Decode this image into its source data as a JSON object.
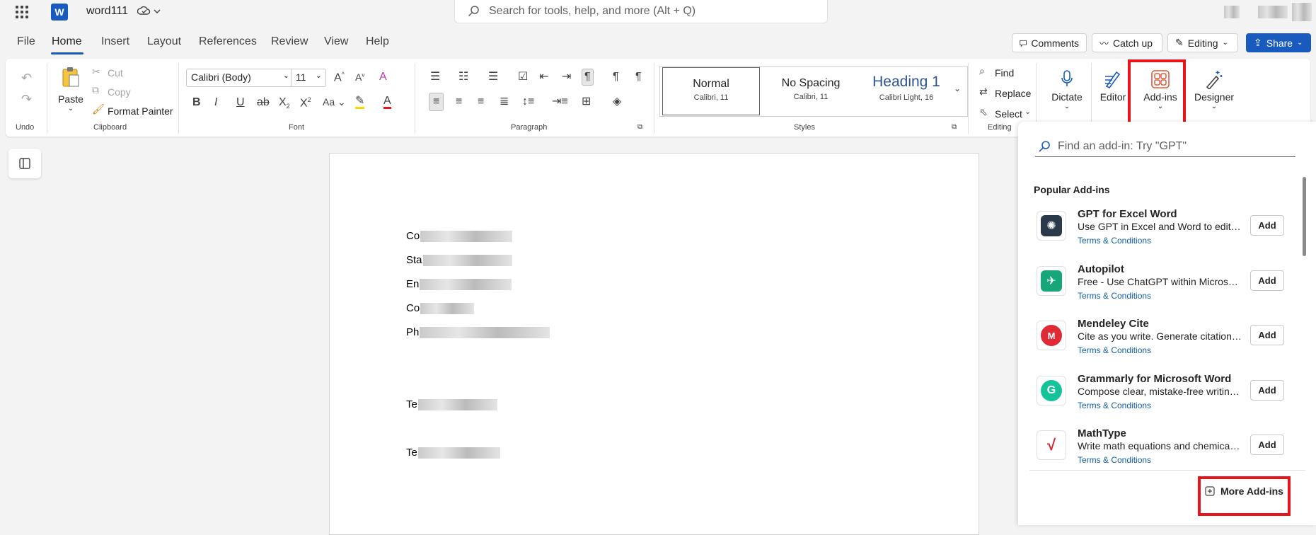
{
  "titlebar": {
    "doc_name": "word111",
    "autosave_icon": "cloud-check-icon",
    "search_placeholder": "Search for tools, help, and more (Alt + Q)"
  },
  "menu": {
    "tabs": [
      "File",
      "Home",
      "Insert",
      "Layout",
      "References",
      "Review",
      "View",
      "Help"
    ],
    "active": "Home",
    "comments": "Comments",
    "catchup": "Catch up",
    "editing": "Editing",
    "share": "Share"
  },
  "ribbon": {
    "undo_group": "Undo",
    "clipboard": {
      "group": "Clipboard",
      "paste": "Paste",
      "cut": "Cut",
      "copy": "Copy",
      "format_painter": "Format Painter"
    },
    "font": {
      "group": "Font",
      "family": "Calibri (Body)",
      "size": "11"
    },
    "paragraph": {
      "group": "Paragraph"
    },
    "styles": {
      "group": "Styles",
      "items": [
        {
          "name": "Normal",
          "sub": "Calibri, 11"
        },
        {
          "name": "No Spacing",
          "sub": "Calibri, 11"
        },
        {
          "name": "Heading 1",
          "sub": "Calibri Light, 16"
        }
      ]
    },
    "editing": {
      "group": "Editing",
      "find": "Find",
      "replace": "Replace",
      "select": "Select"
    },
    "dictate": "Dictate",
    "editor": "Editor",
    "addins": "Add-ins",
    "designer": "Designer",
    "accent": "#185abd",
    "highlight_box_color": "#e8141c"
  },
  "document": {
    "lines": [
      {
        "prefix": "Co"
      },
      {
        "prefix": "Sta"
      },
      {
        "prefix": "En"
      },
      {
        "prefix": "Co"
      },
      {
        "prefix": "Ph"
      },
      {
        "prefix": "Te"
      },
      {
        "prefix": "Te"
      }
    ]
  },
  "addins_pane": {
    "search_placeholder": "Find an add-in: Try \"GPT\"",
    "popular_title": "Popular Add-ins",
    "items": [
      {
        "name": "GPT for Excel Word",
        "desc": "Use GPT in Excel and Word to edit, t...",
        "terms": "Terms & Conditions",
        "add": "Add",
        "icon": "gpt-icon"
      },
      {
        "name": "Autopilot",
        "desc": "Free - Use ChatGPT within Microsoft...",
        "terms": "Terms & Conditions",
        "add": "Add",
        "icon": "autopilot-icon"
      },
      {
        "name": "Mendeley Cite",
        "desc": "Cite as you write. Generate citations ...",
        "terms": "Terms & Conditions",
        "add": "Add",
        "icon": "mendeley-icon"
      },
      {
        "name": "Grammarly for Microsoft Word",
        "desc": "Compose clear, mistake-free writing ...",
        "terms": "Terms & Conditions",
        "add": "Add",
        "icon": "grammarly-icon"
      },
      {
        "name": "MathType",
        "desc": "Write math equations and chemical f...",
        "terms": "Terms & Conditions",
        "add": "Add",
        "icon": "mathtype-icon"
      }
    ],
    "more": "More Add-ins"
  }
}
